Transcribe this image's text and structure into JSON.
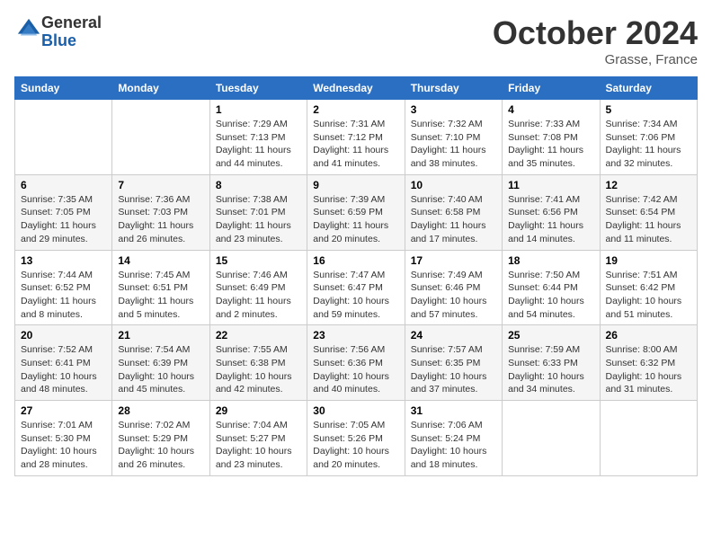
{
  "header": {
    "logo_general": "General",
    "logo_blue": "Blue",
    "month_title": "October 2024",
    "location": "Grasse, France"
  },
  "calendar": {
    "weekdays": [
      "Sunday",
      "Monday",
      "Tuesday",
      "Wednesday",
      "Thursday",
      "Friday",
      "Saturday"
    ],
    "weeks": [
      [
        {
          "day": "",
          "detail": ""
        },
        {
          "day": "",
          "detail": ""
        },
        {
          "day": "1",
          "detail": "Sunrise: 7:29 AM\nSunset: 7:13 PM\nDaylight: 11 hours and 44 minutes."
        },
        {
          "day": "2",
          "detail": "Sunrise: 7:31 AM\nSunset: 7:12 PM\nDaylight: 11 hours and 41 minutes."
        },
        {
          "day": "3",
          "detail": "Sunrise: 7:32 AM\nSunset: 7:10 PM\nDaylight: 11 hours and 38 minutes."
        },
        {
          "day": "4",
          "detail": "Sunrise: 7:33 AM\nSunset: 7:08 PM\nDaylight: 11 hours and 35 minutes."
        },
        {
          "day": "5",
          "detail": "Sunrise: 7:34 AM\nSunset: 7:06 PM\nDaylight: 11 hours and 32 minutes."
        }
      ],
      [
        {
          "day": "6",
          "detail": "Sunrise: 7:35 AM\nSunset: 7:05 PM\nDaylight: 11 hours and 29 minutes."
        },
        {
          "day": "7",
          "detail": "Sunrise: 7:36 AM\nSunset: 7:03 PM\nDaylight: 11 hours and 26 minutes."
        },
        {
          "day": "8",
          "detail": "Sunrise: 7:38 AM\nSunset: 7:01 PM\nDaylight: 11 hours and 23 minutes."
        },
        {
          "day": "9",
          "detail": "Sunrise: 7:39 AM\nSunset: 6:59 PM\nDaylight: 11 hours and 20 minutes."
        },
        {
          "day": "10",
          "detail": "Sunrise: 7:40 AM\nSunset: 6:58 PM\nDaylight: 11 hours and 17 minutes."
        },
        {
          "day": "11",
          "detail": "Sunrise: 7:41 AM\nSunset: 6:56 PM\nDaylight: 11 hours and 14 minutes."
        },
        {
          "day": "12",
          "detail": "Sunrise: 7:42 AM\nSunset: 6:54 PM\nDaylight: 11 hours and 11 minutes."
        }
      ],
      [
        {
          "day": "13",
          "detail": "Sunrise: 7:44 AM\nSunset: 6:52 PM\nDaylight: 11 hours and 8 minutes."
        },
        {
          "day": "14",
          "detail": "Sunrise: 7:45 AM\nSunset: 6:51 PM\nDaylight: 11 hours and 5 minutes."
        },
        {
          "day": "15",
          "detail": "Sunrise: 7:46 AM\nSunset: 6:49 PM\nDaylight: 11 hours and 2 minutes."
        },
        {
          "day": "16",
          "detail": "Sunrise: 7:47 AM\nSunset: 6:47 PM\nDaylight: 10 hours and 59 minutes."
        },
        {
          "day": "17",
          "detail": "Sunrise: 7:49 AM\nSunset: 6:46 PM\nDaylight: 10 hours and 57 minutes."
        },
        {
          "day": "18",
          "detail": "Sunrise: 7:50 AM\nSunset: 6:44 PM\nDaylight: 10 hours and 54 minutes."
        },
        {
          "day": "19",
          "detail": "Sunrise: 7:51 AM\nSunset: 6:42 PM\nDaylight: 10 hours and 51 minutes."
        }
      ],
      [
        {
          "day": "20",
          "detail": "Sunrise: 7:52 AM\nSunset: 6:41 PM\nDaylight: 10 hours and 48 minutes."
        },
        {
          "day": "21",
          "detail": "Sunrise: 7:54 AM\nSunset: 6:39 PM\nDaylight: 10 hours and 45 minutes."
        },
        {
          "day": "22",
          "detail": "Sunrise: 7:55 AM\nSunset: 6:38 PM\nDaylight: 10 hours and 42 minutes."
        },
        {
          "day": "23",
          "detail": "Sunrise: 7:56 AM\nSunset: 6:36 PM\nDaylight: 10 hours and 40 minutes."
        },
        {
          "day": "24",
          "detail": "Sunrise: 7:57 AM\nSunset: 6:35 PM\nDaylight: 10 hours and 37 minutes."
        },
        {
          "day": "25",
          "detail": "Sunrise: 7:59 AM\nSunset: 6:33 PM\nDaylight: 10 hours and 34 minutes."
        },
        {
          "day": "26",
          "detail": "Sunrise: 8:00 AM\nSunset: 6:32 PM\nDaylight: 10 hours and 31 minutes."
        }
      ],
      [
        {
          "day": "27",
          "detail": "Sunrise: 7:01 AM\nSunset: 5:30 PM\nDaylight: 10 hours and 28 minutes."
        },
        {
          "day": "28",
          "detail": "Sunrise: 7:02 AM\nSunset: 5:29 PM\nDaylight: 10 hours and 26 minutes."
        },
        {
          "day": "29",
          "detail": "Sunrise: 7:04 AM\nSunset: 5:27 PM\nDaylight: 10 hours and 23 minutes."
        },
        {
          "day": "30",
          "detail": "Sunrise: 7:05 AM\nSunset: 5:26 PM\nDaylight: 10 hours and 20 minutes."
        },
        {
          "day": "31",
          "detail": "Sunrise: 7:06 AM\nSunset: 5:24 PM\nDaylight: 10 hours and 18 minutes."
        },
        {
          "day": "",
          "detail": ""
        },
        {
          "day": "",
          "detail": ""
        }
      ]
    ]
  }
}
